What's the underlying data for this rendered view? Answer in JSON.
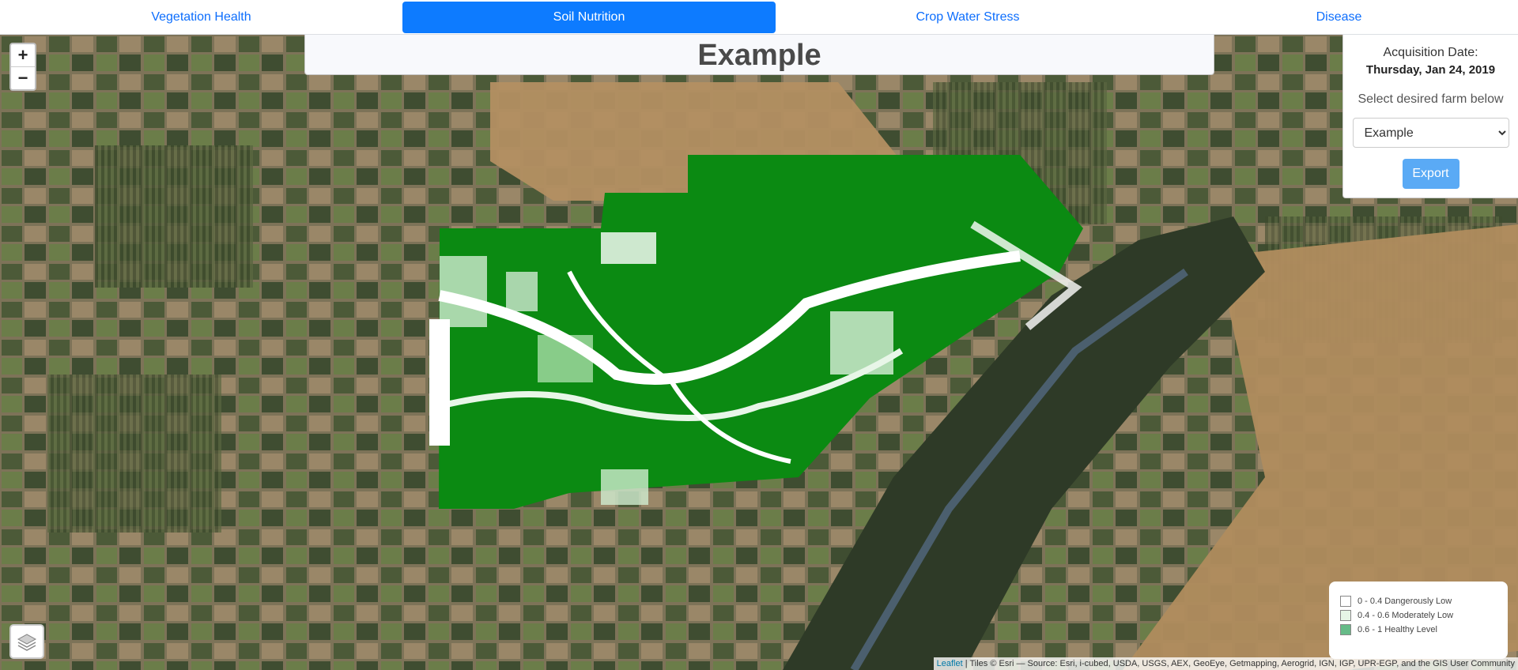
{
  "tabs": [
    {
      "label": "Vegetation Health",
      "active": false
    },
    {
      "label": "Soil Nutrition",
      "active": true
    },
    {
      "label": "Crop Water Stress",
      "active": false
    },
    {
      "label": "Disease",
      "active": false
    }
  ],
  "map": {
    "title": "Example",
    "zoom_in": "+",
    "zoom_out": "−"
  },
  "info_panel": {
    "acquisition_label": "Acquisition Date:",
    "acquisition_date": "Thursday, Jan 24, 2019",
    "select_label": "Select desired farm below",
    "farm_selected": "Example",
    "export_label": "Export"
  },
  "legend": [
    {
      "label": "0 - 0.4 Dangerously Low",
      "color": "#ffffff"
    },
    {
      "label": "0.4 - 0.6 Moderately Low",
      "color": "#e6f5e6"
    },
    {
      "label": "0.6 - 1 Healthy Level",
      "color": "#66bb88"
    }
  ],
  "attribution": {
    "link": "Leaflet",
    "text": " | Tiles © Esri — Source: Esri, i-cubed, USDA, USGS, AEX, GeoEye, Getmapping, Aerogrid, IGN, IGP, UPR-EGP, and the GIS User Community"
  }
}
